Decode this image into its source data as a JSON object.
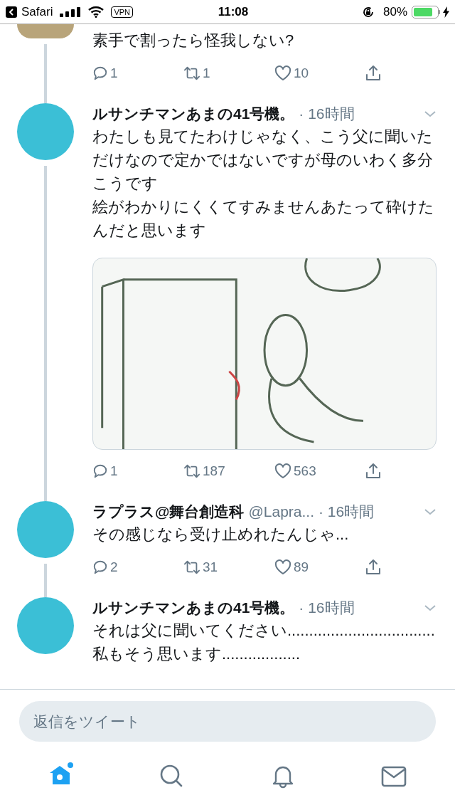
{
  "status_bar": {
    "back_label": "Safari",
    "vpn": "VPN",
    "time": "11:08",
    "battery_text": "80%",
    "battery": {
      "level": 0.8
    },
    "charging": true
  },
  "tweets": [
    {
      "text": [
        "素手で割ったら怪我しない?"
      ],
      "thread_line": true,
      "actions": {
        "reply": "1",
        "retweet": "1",
        "like": "10"
      }
    },
    {
      "author": "ルサンチマンあまの41号機。",
      "time": "· 16時間",
      "text": [
        "わたしも見てたわけじゃなく、こう父に聞いただけなので定かではないですが母のいわく多分こうです",
        "絵がわかりにくくてすみませんあたって砕けたんだと思います"
      ],
      "image": true,
      "thread_line": true,
      "actions": {
        "reply": "1",
        "retweet": "187",
        "like": "563"
      }
    },
    {
      "author": "ラプラス@舞台創造科",
      "handle": "@Lapra...",
      "time": "· 16時間",
      "text": [
        "その感じなら受け止めれたんじゃ..."
      ],
      "thread_line": true,
      "actions": {
        "reply": "2",
        "retweet": "31",
        "like": "89"
      }
    },
    {
      "author": "ルサンチマンあまの41号機。",
      "time": "· 16時間",
      "text": [
        "それは父に聞いてください..................................私もそう思います.................."
      ]
    }
  ],
  "reply_field": {
    "placeholder": "返信をツイート"
  },
  "tab_bar": [
    {
      "kind": "home",
      "selected": true,
      "badge": true
    },
    {
      "kind": "search",
      "selected": false
    },
    {
      "kind": "notifications",
      "selected": false
    },
    {
      "kind": "messages",
      "selected": false
    }
  ]
}
